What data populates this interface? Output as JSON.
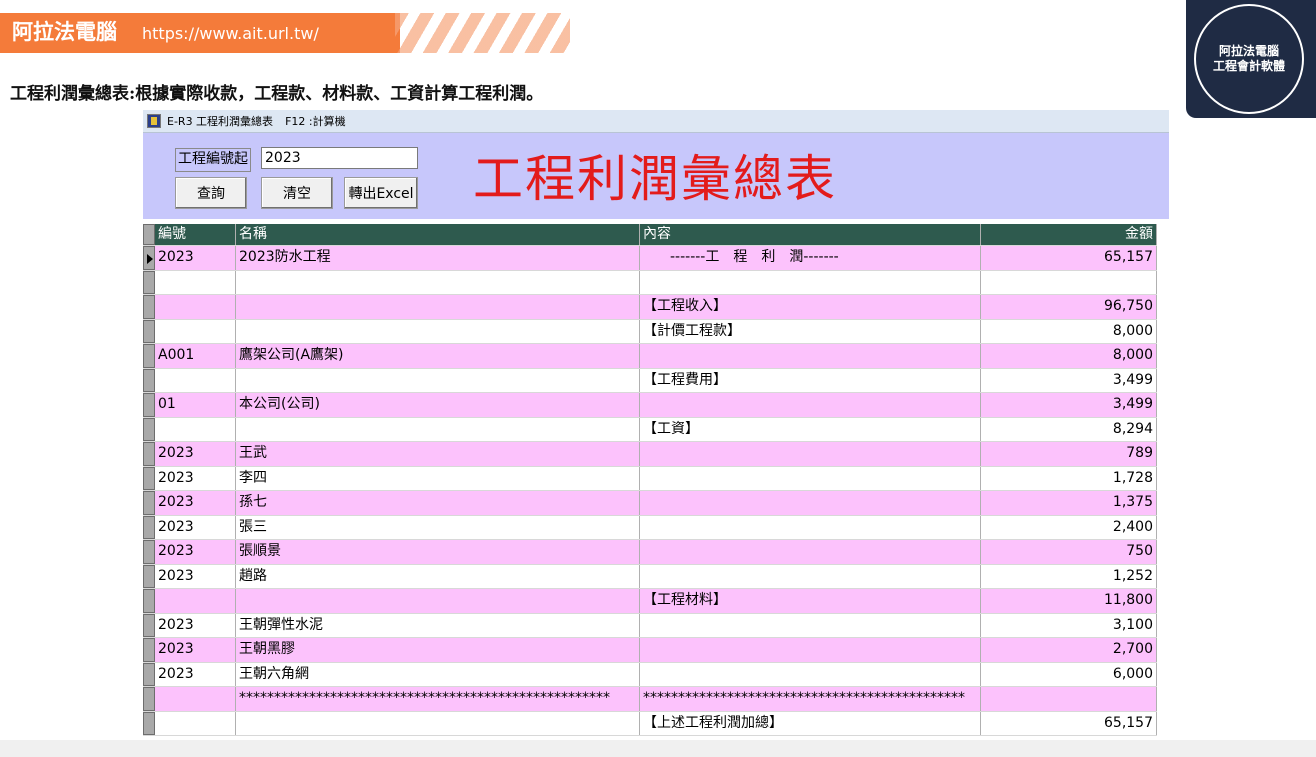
{
  "brand": {
    "name": "阿拉法電腦",
    "url": "https://www.ait.url.tw/"
  },
  "badge": {
    "line1": "阿拉法電腦",
    "line2": "工程會計軟體"
  },
  "subtitle": "工程利潤彙總表:根據實際收款，工程款、材料款、工資計算工程利潤。",
  "window": {
    "title": "E-R3 工程利潤彙總表",
    "hotkey": "F12 :計算機"
  },
  "form": {
    "project_label": "工程編號起",
    "project_value": "2023",
    "query_button": "查詢",
    "clear_button": "清空",
    "export_button": "轉出Excel",
    "big_title": "工程利潤彙總表"
  },
  "colors": {
    "header_bg": "#2e5a4e",
    "row_pink": "#fcc2fc",
    "panel_bg": "#c7c7fb",
    "title_red": "#e31b1b",
    "brand_orange": "#f47b3a"
  },
  "table": {
    "columns": [
      "編號",
      "名稱",
      "內容",
      "金額"
    ],
    "rows": [
      {
        "id": "2023",
        "name": "2023防水工程",
        "content": "-------工　程　利　潤-------",
        "amount": "65,157"
      },
      {
        "id": "",
        "name": "",
        "content": "",
        "amount": ""
      },
      {
        "id": "",
        "name": "",
        "content": "【工程收入】",
        "amount": "96,750"
      },
      {
        "id": "",
        "name": "",
        "content": "【計價工程款】",
        "amount": "8,000"
      },
      {
        "id": "A001",
        "name": "鷹架公司(A鷹架)",
        "content": "",
        "amount": "8,000"
      },
      {
        "id": "",
        "name": "",
        "content": "【工程費用】",
        "amount": "3,499"
      },
      {
        "id": "01",
        "name": "本公司(公司)",
        "content": "",
        "amount": "3,499"
      },
      {
        "id": "",
        "name": "",
        "content": "【工資】",
        "amount": "8,294"
      },
      {
        "id": "2023",
        "name": "王武",
        "content": "",
        "amount": "789"
      },
      {
        "id": "2023",
        "name": "李四",
        "content": "",
        "amount": "1,728"
      },
      {
        "id": "2023",
        "name": "孫七",
        "content": "",
        "amount": "1,375"
      },
      {
        "id": "2023",
        "name": "張三",
        "content": "",
        "amount": "2,400"
      },
      {
        "id": "2023",
        "name": "張順景",
        "content": "",
        "amount": "750"
      },
      {
        "id": "2023",
        "name": "趙路",
        "content": "",
        "amount": "1,252"
      },
      {
        "id": "",
        "name": "",
        "content": "【工程材料】",
        "amount": "11,800"
      },
      {
        "id": "2023",
        "name": "王朝彈性水泥",
        "content": "",
        "amount": "3,100"
      },
      {
        "id": "2023",
        "name": "王朝黑膠",
        "content": "",
        "amount": "2,700"
      },
      {
        "id": "2023",
        "name": "王朝六角網",
        "content": "",
        "amount": "6,000"
      },
      {
        "id": "",
        "name": "*****************************************************",
        "content": "**********************************************",
        "amount": ""
      },
      {
        "id": "",
        "name": "",
        "content": "【上述工程利潤加總】",
        "amount": "65,157"
      }
    ]
  }
}
